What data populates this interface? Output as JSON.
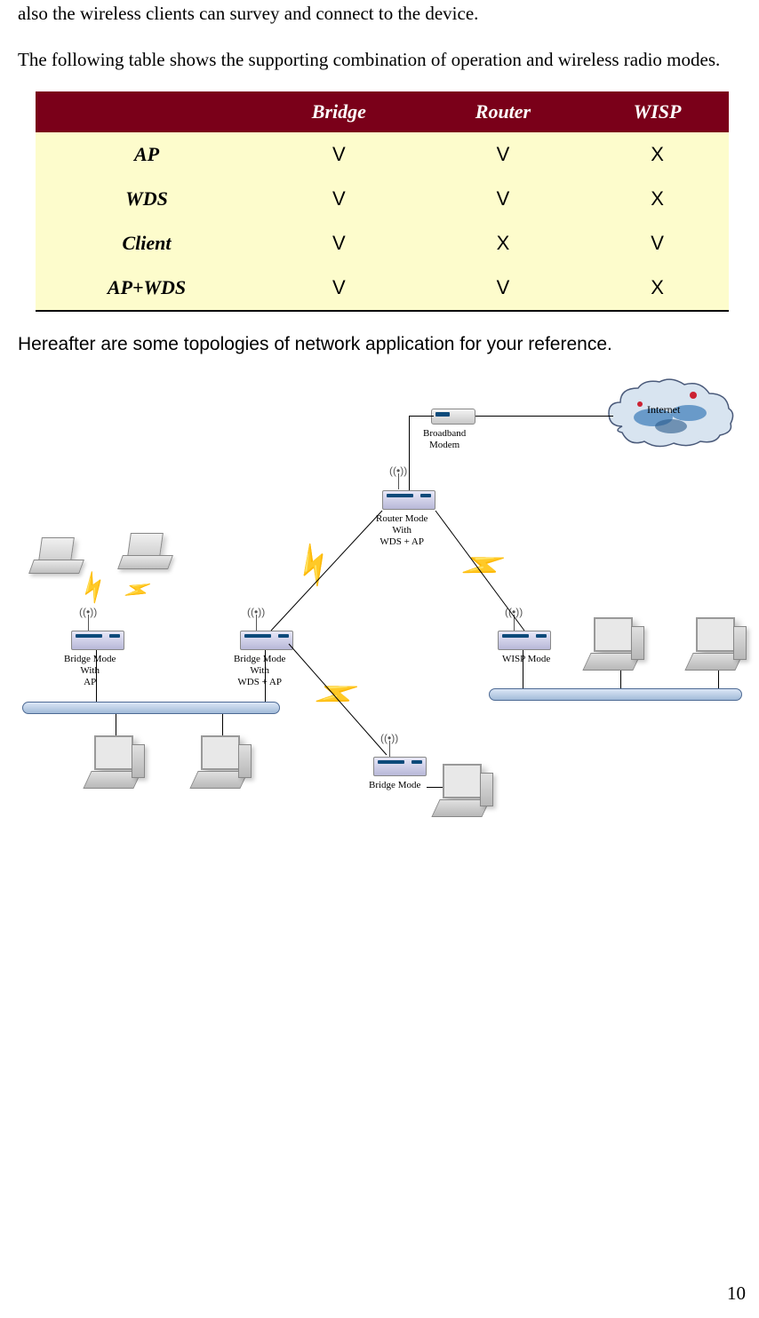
{
  "intro": {
    "line1": "also the wireless clients can survey and connect to the device.",
    "line2": "The following table shows the supporting combination of operation and wireless radio modes."
  },
  "table": {
    "headers": [
      "",
      "Bridge",
      "Router",
      "WISP"
    ],
    "rows": [
      {
        "label": "AP",
        "cells": [
          "V",
          "V",
          "X"
        ]
      },
      {
        "label": "WDS",
        "cells": [
          "V",
          "V",
          "X"
        ]
      },
      {
        "label": "Client",
        "cells": [
          "V",
          "X",
          "V"
        ]
      },
      {
        "label": "AP+WDS",
        "cells": [
          "V",
          "V",
          "X"
        ]
      }
    ]
  },
  "topology_text": "Hereafter are some topologies of network application for your reference.",
  "diagram_labels": {
    "internet": "Internet",
    "broadband_modem": "Broadband\nModem",
    "router_mode": "Router Mode\nWith\nWDS + AP",
    "bridge_ap": "Bridge Mode\nWith\nAP",
    "bridge_wds_ap": "Bridge Mode\nWith\nWDS + AP",
    "wisp_mode": "WISP Mode",
    "bridge_mode": "Bridge Mode"
  },
  "page_number": "10"
}
